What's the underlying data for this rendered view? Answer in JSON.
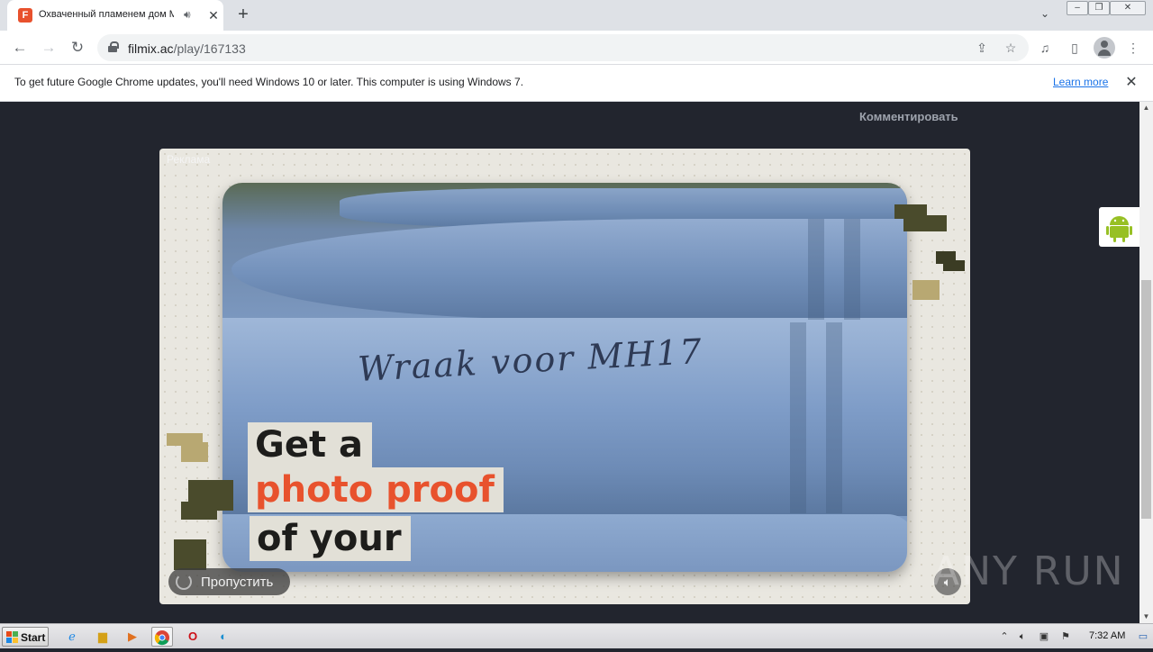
{
  "browser": {
    "tab_title": "Охваченный пламенем дом Мэ",
    "tab_favicon_letter": "F",
    "url_host": "filmix.ac",
    "url_path": "/play/167133",
    "infobar_text": "To get future Google Chrome updates, you'll need Windows 10 or later. This computer is using Windows 7.",
    "infobar_link": "Learn more"
  },
  "page": {
    "comment_link": "Комментировать",
    "ad": {
      "label": "Реклама",
      "video_scribble": "Wraak voor MH17",
      "overlay_lines": [
        "Get a",
        "photo proof",
        "of your"
      ],
      "skip_label": "Пропустить"
    },
    "watermark": "ANY RUN"
  },
  "taskbar": {
    "start_label": "Start",
    "clock": "7:32 AM"
  },
  "colors": {
    "page_bg": "#22252e",
    "accent_orange": "#e8522d",
    "link_blue": "#1a73e8"
  }
}
